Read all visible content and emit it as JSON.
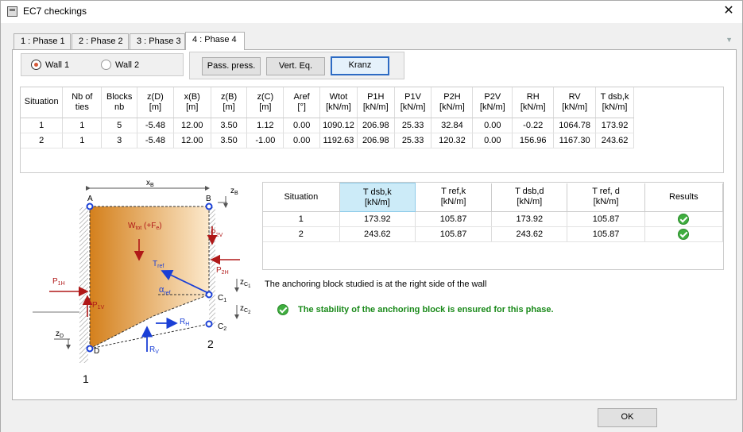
{
  "window": {
    "title": "EC7 checkings",
    "close": "✕"
  },
  "tabs": [
    "1 : Phase 1",
    "2 : Phase 2",
    "3 : Phase 3",
    "4 : Phase 4"
  ],
  "active_tab": 3,
  "walls": [
    {
      "label": "Wall 1",
      "selected": true
    },
    {
      "label": "Wall 2",
      "selected": false
    }
  ],
  "modes": [
    {
      "label": "Pass. press."
    },
    {
      "label": "Vert. Eq."
    },
    {
      "label": "Kranz",
      "selected": true
    }
  ],
  "table1": {
    "headers": [
      [
        "Situation"
      ],
      [
        "Nb of",
        "ties"
      ],
      [
        "Blocks",
        "nb"
      ],
      [
        "z(D)",
        "[m]"
      ],
      [
        "x(B)",
        "[m]"
      ],
      [
        "z(B)",
        "[m]"
      ],
      [
        "z(C)",
        "[m]"
      ],
      [
        "Aref",
        "[°]"
      ],
      [
        "Wtot",
        "[kN/m]"
      ],
      [
        "P1H",
        "[kN/m]"
      ],
      [
        "P1V",
        "[kN/m]"
      ],
      [
        "P2H",
        "[kN/m]"
      ],
      [
        "P2V",
        "[kN/m]"
      ],
      [
        "RH",
        "[kN/m]"
      ],
      [
        "RV",
        "[kN/m]"
      ],
      [
        "T dsb,k",
        "[kN/m]"
      ]
    ],
    "rows": [
      [
        "1",
        "1",
        "5",
        "-5.48",
        "12.00",
        "3.50",
        "1.12",
        "0.00",
        "1090.12",
        "206.98",
        "25.33",
        "32.84",
        "0.00",
        "-0.22",
        "1064.78",
        "173.92"
      ],
      [
        "2",
        "1",
        "3",
        "-5.48",
        "12.00",
        "3.50",
        "-1.00",
        "0.00",
        "1192.63",
        "206.98",
        "25.33",
        "120.32",
        "0.00",
        "156.96",
        "1167.30",
        "243.62"
      ]
    ]
  },
  "table2": {
    "headers": [
      [
        "Situation"
      ],
      [
        "T dsb,k",
        "[kN/m]"
      ],
      [
        "T ref,k",
        "[kN/m]"
      ],
      [
        "T dsb,d",
        "[kN/m]"
      ],
      [
        "T ref, d",
        "[kN/m]"
      ],
      [
        "Results"
      ]
    ],
    "rows": [
      [
        "1",
        "173.92",
        "105.87",
        "173.92",
        "105.87"
      ],
      [
        "2",
        "243.62",
        "105.87",
        "243.62",
        "105.87"
      ]
    ]
  },
  "info": "The anchoring block studied is at the right side of the wall",
  "result": "The stability of the anchoring block is ensured for this phase.",
  "ok": "OK",
  "colors": {
    "block_dark": "#d4801c",
    "block_light": "#fce9cc",
    "force_red": "#b01818",
    "force_blue": "#1a3fd6",
    "ok_green": "#1a8a1a",
    "tab_highlight": "#ccebf8"
  },
  "diagram": {
    "xb": "x",
    "xb_sub": "B",
    "zb": "z",
    "zb_sub": "B",
    "A": "A",
    "B": "B",
    "C1": "C",
    "C1_sub": "1",
    "C2": "C",
    "C2_sub": "2",
    "D": "D",
    "wall1": "1",
    "wall2": "2",
    "Wtot": "W",
    "Wtot_sub": "tot",
    "Wtot_rest": " (+F",
    "Wtot_e": "e",
    "Wtot_close": ")",
    "P2V": "P",
    "P2V_sub": "2V",
    "P2H": "P",
    "P2H_sub": "2H",
    "Tref": "T",
    "Tref_sub": "ref",
    "alpha": "α",
    "alpha_sub": "ref",
    "P1H": "P",
    "P1H_sub": "1H",
    "P1V": "P",
    "P1V_sub": "1V",
    "RH": "R",
    "RH_sub": "H",
    "RV": "R",
    "RV_sub": "V",
    "zC1": "z",
    "zC1_sub": "C",
    "zC1_subsub": "1",
    "zC2": "z",
    "zC2_sub": "C",
    "zC2_subsub": "2",
    "zD": "z",
    "zD_sub": "D"
  }
}
